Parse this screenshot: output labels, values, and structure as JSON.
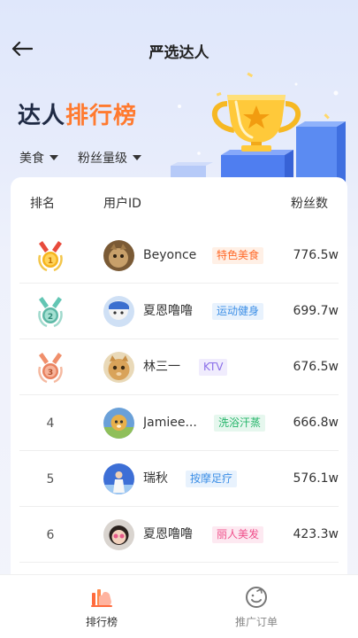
{
  "header": {
    "title": "严选达人"
  },
  "hero": {
    "title_part1": "达人",
    "title_part2": "排行榜",
    "accent_color": "#ff7a2f"
  },
  "filters": [
    {
      "label": "美食",
      "icon": "caret-down-icon"
    },
    {
      "label": "粉丝量级",
      "icon": "caret-down-icon"
    }
  ],
  "table": {
    "columns": [
      "排名",
      "用户ID",
      "粉丝数"
    ],
    "rows": [
      {
        "rank": "1",
        "medal": "gold-medal-icon",
        "name": "Beyonce",
        "tag": "特色美食",
        "tag_color": "#ff6a2a",
        "tag_bg": "#fff0e6",
        "fans": "776.5w"
      },
      {
        "rank": "2",
        "medal": "silver-medal-icon",
        "name": "夏恩噜噜",
        "tag": "运动健身",
        "tag_color": "#3d8fe6",
        "tag_bg": "#e8f2fd",
        "fans": "699.7w"
      },
      {
        "rank": "3",
        "medal": "bronze-medal-icon",
        "name": "林三一",
        "tag": "KTV",
        "tag_color": "#8a6ee8",
        "tag_bg": "#f0ecfd",
        "fans": "676.5w"
      },
      {
        "rank": "4",
        "medal": "",
        "name": "Jamiee...",
        "tag": "洗浴汗蒸",
        "tag_color": "#25b56a",
        "tag_bg": "#e6f7ee",
        "fans": "666.8w"
      },
      {
        "rank": "5",
        "medal": "",
        "name": "瑞秋",
        "tag": "按摩足疗",
        "tag_color": "#3d8fe6",
        "tag_bg": "#e8f2fd",
        "fans": "576.1w"
      },
      {
        "rank": "6",
        "medal": "",
        "name": "夏恩噜噜",
        "tag": "丽人美发",
        "tag_color": "#ef4f8a",
        "tag_bg": "#fde9f1",
        "fans": "423.3w"
      }
    ]
  },
  "tabbar": [
    {
      "label": "排行榜",
      "icon": "ranking-hand-icon",
      "active": true,
      "color": "#333333"
    },
    {
      "label": "推广订单",
      "icon": "orders-smile-icon",
      "active": false,
      "color": "#888888"
    }
  ]
}
